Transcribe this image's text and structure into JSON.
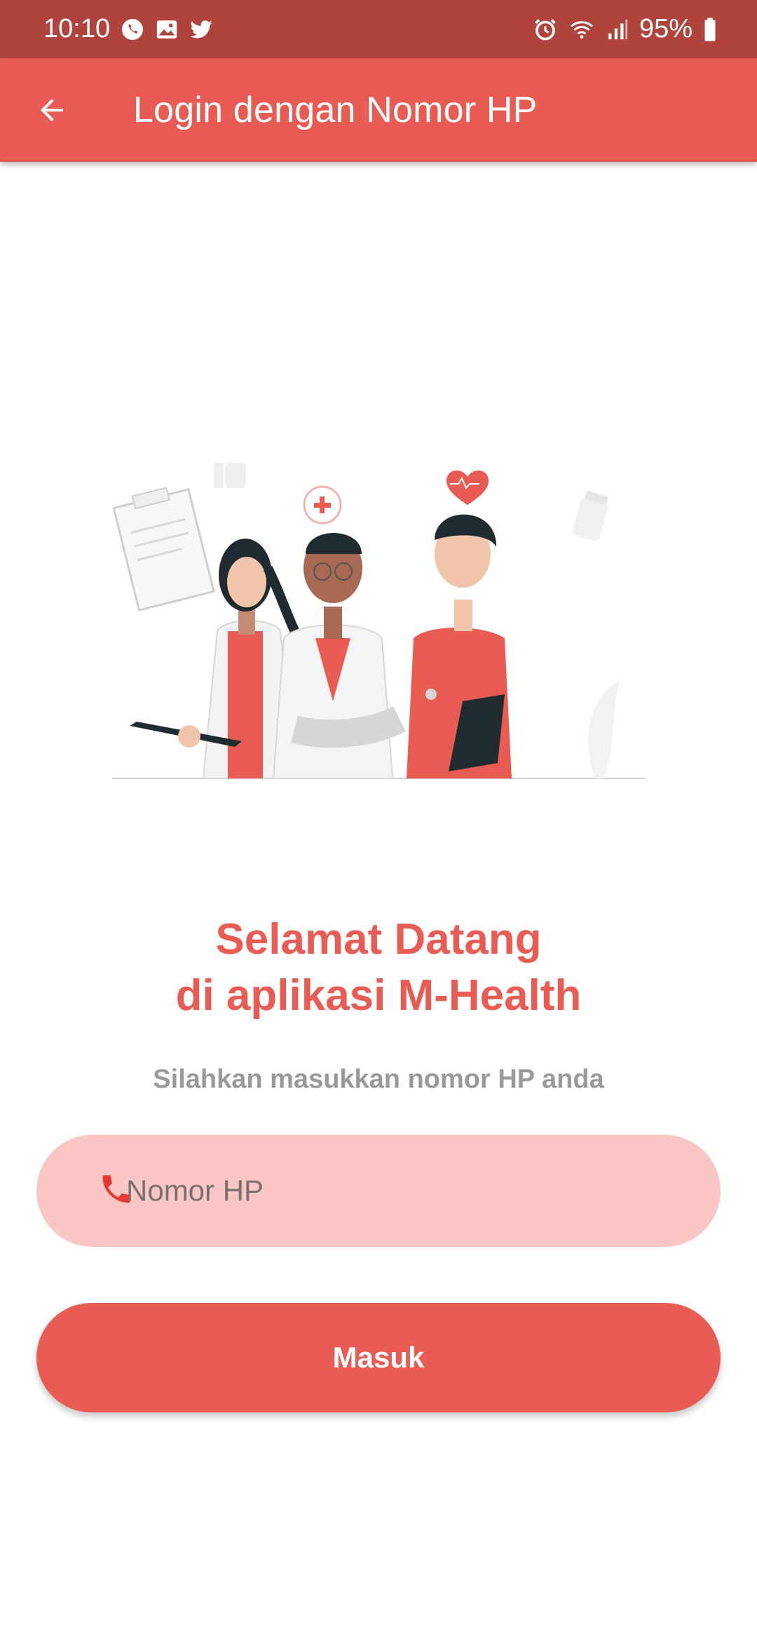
{
  "status_bar": {
    "time": "10:10",
    "battery": "95%",
    "notification_icons": [
      "whatsapp-icon",
      "gallery-icon",
      "twitter-icon"
    ],
    "system_icons": [
      "alarm-icon",
      "wifi-icon",
      "signal-icon",
      "battery-icon"
    ]
  },
  "app_bar": {
    "title": "Login dengan Nomor HP",
    "back_icon": "arrow-left-icon"
  },
  "welcome": {
    "line1": "Selamat Datang",
    "line2": "di aplikasi M-Health",
    "subtitle": "Silahkan masukkan nomor HP anda"
  },
  "phone_field": {
    "placeholder": "Nomor HP",
    "value": "",
    "icon": "phone-icon"
  },
  "submit": {
    "label": "Masuk"
  },
  "colors": {
    "primary": "#e85c53",
    "status_bar": "#b0443d",
    "field_bg": "#fbc7c4",
    "subtitle": "#9a9a9a"
  }
}
